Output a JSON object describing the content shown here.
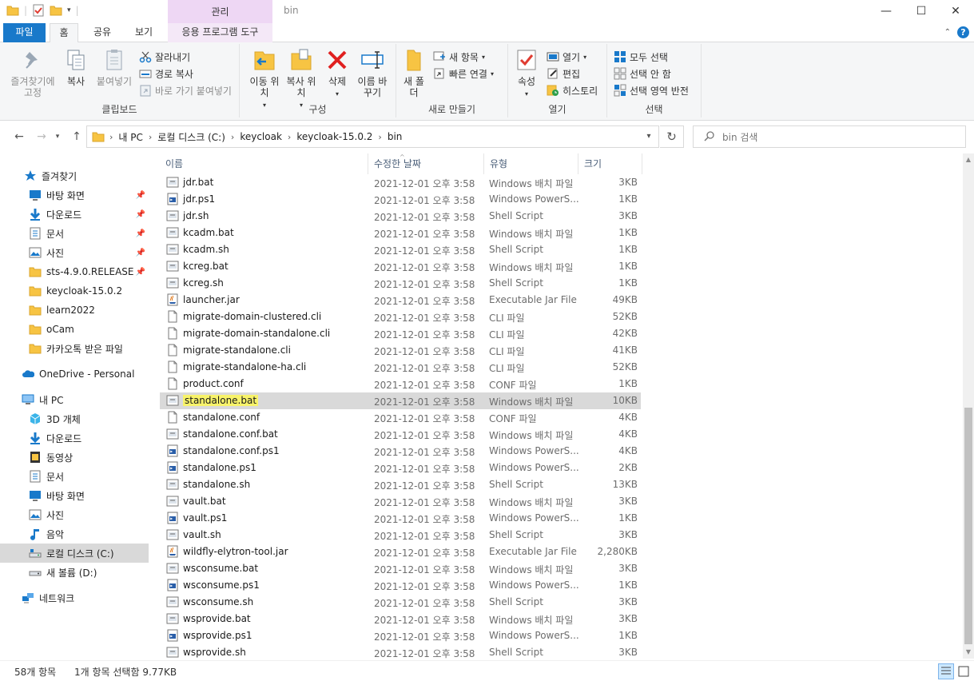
{
  "window": {
    "title": "bin",
    "context_tab_header": "관리",
    "minimize": "—",
    "maximize": "☐",
    "close": "✕"
  },
  "tabs": {
    "file": "파일",
    "home": "홈",
    "share": "공유",
    "view": "보기",
    "app_tools": "응용 프로그램 도구"
  },
  "ribbon": {
    "clipboard": {
      "label": "클립보드",
      "pin_quick": "즐겨찾기에 고정",
      "copy": "복사",
      "paste": "붙여넣기",
      "cut": "잘라내기",
      "copy_path": "경로 복사",
      "paste_shortcut": "바로 가기 붙여넣기"
    },
    "organize": {
      "label": "구성",
      "move_to": "이동 위치",
      "copy_to": "복사 위치",
      "delete": "삭제",
      "rename": "이름 바꾸기"
    },
    "new": {
      "label": "새로 만들기",
      "new_folder": "새 폴더",
      "new_item": "새 항목",
      "easy_access": "빠른 연결"
    },
    "open": {
      "label": "열기",
      "properties": "속성",
      "open": "열기",
      "edit": "편집",
      "history": "히스토리"
    },
    "select": {
      "label": "선택",
      "select_all": "모두 선택",
      "select_none": "선택 안 함",
      "invert": "선택 영역 반전"
    }
  },
  "address": {
    "crumbs": [
      "내 PC",
      "로컬 디스크 (C:)",
      "keycloak",
      "keycloak-15.0.2",
      "bin"
    ],
    "search_placeholder": "bin 검색"
  },
  "nav": {
    "quick_access": "즐겨찾기",
    "quick_items": [
      "바탕 화면",
      "다운로드",
      "문서",
      "사진",
      "sts-4.9.0.RELEASE",
      "keycloak-15.0.2",
      "learn2022",
      "oCam",
      "카카오톡 받은 파일"
    ],
    "onedrive": "OneDrive - Personal",
    "this_pc": "내 PC",
    "pc_items": [
      "3D 개체",
      "다운로드",
      "동영상",
      "문서",
      "바탕 화면",
      "사진",
      "음악",
      "로컬 디스크 (C:)",
      "새 볼륨 (D:)"
    ],
    "network": "네트워크"
  },
  "columns": {
    "name": "이름",
    "date": "수정한 날짜",
    "type": "유형",
    "size": "크기"
  },
  "files": [
    {
      "name": "jdr.bat",
      "date": "2021-12-01 오후 3:58",
      "type": "Windows 배치 파일",
      "size": "3KB",
      "icon": "bat"
    },
    {
      "name": "jdr.ps1",
      "date": "2021-12-01 오후 3:58",
      "type": "Windows PowerS...",
      "size": "1KB",
      "icon": "ps1"
    },
    {
      "name": "jdr.sh",
      "date": "2021-12-01 오후 3:58",
      "type": "Shell Script",
      "size": "3KB",
      "icon": "sh"
    },
    {
      "name": "kcadm.bat",
      "date": "2021-12-01 오후 3:58",
      "type": "Windows 배치 파일",
      "size": "1KB",
      "icon": "bat"
    },
    {
      "name": "kcadm.sh",
      "date": "2021-12-01 오후 3:58",
      "type": "Shell Script",
      "size": "1KB",
      "icon": "sh"
    },
    {
      "name": "kcreg.bat",
      "date": "2021-12-01 오후 3:58",
      "type": "Windows 배치 파일",
      "size": "1KB",
      "icon": "bat"
    },
    {
      "name": "kcreg.sh",
      "date": "2021-12-01 오후 3:58",
      "type": "Shell Script",
      "size": "1KB",
      "icon": "sh"
    },
    {
      "name": "launcher.jar",
      "date": "2021-12-01 오후 3:58",
      "type": "Executable Jar File",
      "size": "49KB",
      "icon": "jar"
    },
    {
      "name": "migrate-domain-clustered.cli",
      "date": "2021-12-01 오후 3:58",
      "type": "CLI 파일",
      "size": "52KB",
      "icon": "doc"
    },
    {
      "name": "migrate-domain-standalone.cli",
      "date": "2021-12-01 오후 3:58",
      "type": "CLI 파일",
      "size": "42KB",
      "icon": "doc"
    },
    {
      "name": "migrate-standalone.cli",
      "date": "2021-12-01 오후 3:58",
      "type": "CLI 파일",
      "size": "41KB",
      "icon": "doc"
    },
    {
      "name": "migrate-standalone-ha.cli",
      "date": "2021-12-01 오후 3:58",
      "type": "CLI 파일",
      "size": "52KB",
      "icon": "doc"
    },
    {
      "name": "product.conf",
      "date": "2021-12-01 오후 3:58",
      "type": "CONF 파일",
      "size": "1KB",
      "icon": "doc"
    },
    {
      "name": "standalone.bat",
      "date": "2021-12-01 오후 3:58",
      "type": "Windows 배치 파일",
      "size": "10KB",
      "icon": "bat",
      "selected": true
    },
    {
      "name": "standalone.conf",
      "date": "2021-12-01 오후 3:58",
      "type": "CONF 파일",
      "size": "4KB",
      "icon": "doc"
    },
    {
      "name": "standalone.conf.bat",
      "date": "2021-12-01 오후 3:58",
      "type": "Windows 배치 파일",
      "size": "4KB",
      "icon": "bat"
    },
    {
      "name": "standalone.conf.ps1",
      "date": "2021-12-01 오후 3:58",
      "type": "Windows PowerS...",
      "size": "4KB",
      "icon": "ps1"
    },
    {
      "name": "standalone.ps1",
      "date": "2021-12-01 오후 3:58",
      "type": "Windows PowerS...",
      "size": "2KB",
      "icon": "ps1"
    },
    {
      "name": "standalone.sh",
      "date": "2021-12-01 오후 3:58",
      "type": "Shell Script",
      "size": "13KB",
      "icon": "sh"
    },
    {
      "name": "vault.bat",
      "date": "2021-12-01 오후 3:58",
      "type": "Windows 배치 파일",
      "size": "3KB",
      "icon": "bat"
    },
    {
      "name": "vault.ps1",
      "date": "2021-12-01 오후 3:58",
      "type": "Windows PowerS...",
      "size": "1KB",
      "icon": "ps1"
    },
    {
      "name": "vault.sh",
      "date": "2021-12-01 오후 3:58",
      "type": "Shell Script",
      "size": "3KB",
      "icon": "sh"
    },
    {
      "name": "wildfly-elytron-tool.jar",
      "date": "2021-12-01 오후 3:58",
      "type": "Executable Jar File",
      "size": "2,280KB",
      "icon": "jar"
    },
    {
      "name": "wsconsume.bat",
      "date": "2021-12-01 오후 3:58",
      "type": "Windows 배치 파일",
      "size": "3KB",
      "icon": "bat"
    },
    {
      "name": "wsconsume.ps1",
      "date": "2021-12-01 오후 3:58",
      "type": "Windows PowerS...",
      "size": "1KB",
      "icon": "ps1"
    },
    {
      "name": "wsconsume.sh",
      "date": "2021-12-01 오후 3:58",
      "type": "Shell Script",
      "size": "3KB",
      "icon": "sh"
    },
    {
      "name": "wsprovide.bat",
      "date": "2021-12-01 오후 3:58",
      "type": "Windows 배치 파일",
      "size": "3KB",
      "icon": "bat"
    },
    {
      "name": "wsprovide.ps1",
      "date": "2021-12-01 오후 3:58",
      "type": "Windows PowerS...",
      "size": "1KB",
      "icon": "ps1"
    },
    {
      "name": "wsprovide.sh",
      "date": "2021-12-01 오후 3:58",
      "type": "Shell Script",
      "size": "3KB",
      "icon": "sh"
    }
  ],
  "status": {
    "item_count": "58개 항목",
    "selection": "1개 항목 선택함 9.77KB"
  },
  "colors": {
    "accent": "#1979ca",
    "selection_row": "#d9d9d9",
    "highlight_marker": "#f8f36a",
    "context_tab": "#eed7f4"
  }
}
